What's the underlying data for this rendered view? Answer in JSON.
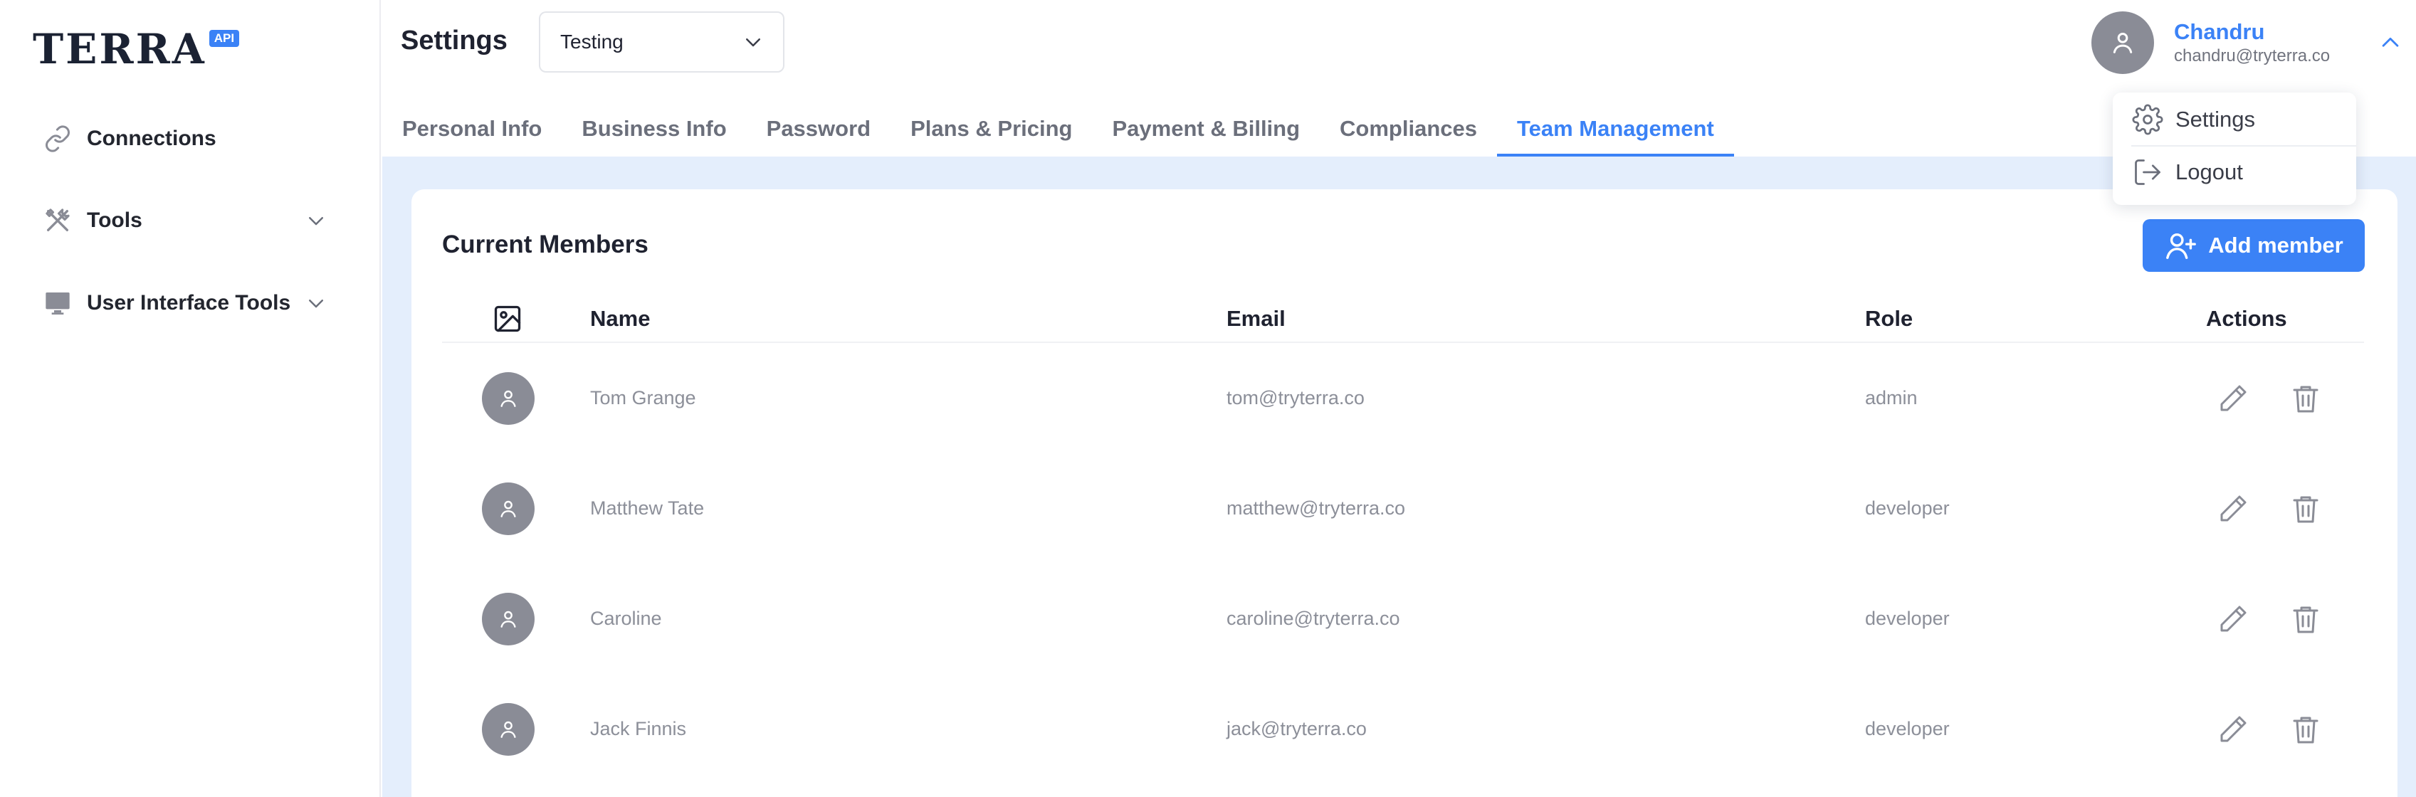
{
  "brand": {
    "logo_text": "TERRA",
    "badge": "API",
    "accent": "#3b82f6"
  },
  "sidebar": {
    "items": [
      {
        "label": "Connections",
        "icon": "link-icon",
        "expandable": false
      },
      {
        "label": "Tools",
        "icon": "tools-icon",
        "expandable": true
      },
      {
        "label": "User Interface Tools",
        "icon": "monitor-icon",
        "expandable": true
      }
    ]
  },
  "header": {
    "title": "Settings",
    "environment_select": {
      "value": "Testing"
    },
    "tabs": [
      {
        "label": "Personal Info",
        "active": false
      },
      {
        "label": "Business Info",
        "active": false
      },
      {
        "label": "Password",
        "active": false
      },
      {
        "label": "Plans & Pricing",
        "active": false
      },
      {
        "label": "Payment & Billing",
        "active": false
      },
      {
        "label": "Compliances",
        "active": false
      },
      {
        "label": "Team Management",
        "active": true
      }
    ],
    "user": {
      "name": "Chandru",
      "email": "chandru@tryterra.co"
    }
  },
  "user_menu": {
    "open": true,
    "items": [
      {
        "label": "Settings",
        "icon": "gear-icon"
      },
      {
        "label": "Logout",
        "icon": "logout-icon"
      }
    ]
  },
  "members": {
    "title": "Current Members",
    "add_button": "Add member",
    "columns": {
      "image": "image-icon",
      "name": "Name",
      "email": "Email",
      "role": "Role",
      "actions": "Actions"
    },
    "rows": [
      {
        "name": "Tom Grange",
        "email": "tom@tryterra.co",
        "role": "admin"
      },
      {
        "name": "Matthew Tate",
        "email": "matthew@tryterra.co",
        "role": "developer"
      },
      {
        "name": "Caroline",
        "email": "caroline@tryterra.co",
        "role": "developer"
      },
      {
        "name": "Jack Finnis",
        "email": "jack@tryterra.co",
        "role": "developer"
      }
    ]
  },
  "colors": {
    "accent": "#3b82f6",
    "content_bg": "#e4eefc",
    "avatar_bg": "#8a8c96",
    "muted_text": "#8c8f99"
  }
}
